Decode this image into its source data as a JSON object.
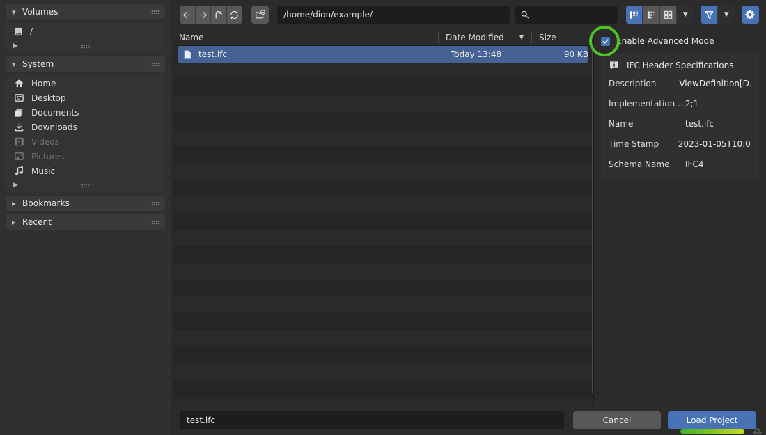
{
  "theme": {
    "accent_blue": "#4772b3",
    "selection_blue": "#466193",
    "highlight_green": "#4fc229",
    "panel_bg": "#2b2b2b",
    "sidebar_bg": "#303030",
    "list_bg": "#282828"
  },
  "sidebar": {
    "sections": [
      {
        "id": "volumes",
        "title": "Volumes",
        "expanded": true,
        "items": [
          {
            "label": "/",
            "icon": "drive-icon"
          }
        ]
      },
      {
        "id": "system",
        "title": "System",
        "expanded": true,
        "items": [
          {
            "label": "Home",
            "icon": "home-icon",
            "enabled": true
          },
          {
            "label": "Desktop",
            "icon": "desktop-icon",
            "enabled": true
          },
          {
            "label": "Documents",
            "icon": "documents-icon",
            "enabled": true
          },
          {
            "label": "Downloads",
            "icon": "download-icon",
            "enabled": true
          },
          {
            "label": "Videos",
            "icon": "video-icon",
            "enabled": false
          },
          {
            "label": "Pictures",
            "icon": "image-icon",
            "enabled": false
          },
          {
            "label": "Music",
            "icon": "music-icon",
            "enabled": true
          }
        ]
      },
      {
        "id": "bookmarks",
        "title": "Bookmarks",
        "expanded": false,
        "items": []
      },
      {
        "id": "recent",
        "title": "Recent",
        "expanded": false,
        "items": []
      }
    ]
  },
  "toolbar": {
    "nav": [
      {
        "name": "back-button",
        "icon": "arrow-left-icon"
      },
      {
        "name": "forward-button",
        "icon": "arrow-right-icon"
      },
      {
        "name": "parent-button",
        "icon": "arrow-up-icon"
      },
      {
        "name": "refresh-button",
        "icon": "refresh-icon"
      }
    ],
    "new_folder": {
      "name": "new-folder-button",
      "icon": "new-folder-icon"
    },
    "path": {
      "value": "/home/dion/example/",
      "placeholder": ""
    },
    "search": {
      "value": "",
      "placeholder": "",
      "icon": "search-icon"
    },
    "display_modes": [
      {
        "name": "vertical-list-view",
        "icon": "list-view-icon",
        "active": true
      },
      {
        "name": "horizontal-list-view",
        "icon": "detail-view-icon",
        "active": false
      },
      {
        "name": "thumbnail-view",
        "icon": "grid-view-icon",
        "active": false
      }
    ],
    "display_dropdown_icon": "chevron-down-icon",
    "filter": {
      "name": "filter-toggle",
      "icon": "funnel-icon",
      "active": true
    },
    "filter_dropdown_icon": "chevron-down-icon",
    "settings": {
      "name": "settings-button",
      "icon": "gear-icon"
    }
  },
  "filelist": {
    "columns": [
      {
        "key": "name",
        "label": "Name",
        "sorted": false
      },
      {
        "key": "date",
        "label": "Date Modified",
        "sorted": true,
        "direction": "desc"
      },
      {
        "key": "size",
        "label": "Size",
        "sorted": false
      }
    ],
    "files": [
      {
        "name": "test.ifc",
        "date": "Today 13:48",
        "size": "90 KB",
        "icon": "file-icon",
        "selected": true
      }
    ],
    "empty_row_count": 21
  },
  "rightpanel": {
    "advanced_mode": {
      "label": "Enable Advanced Mode",
      "checked": true
    },
    "card": {
      "title": "IFC Header Specifications",
      "icon": "info-icon",
      "properties": [
        {
          "key": "Description",
          "value": "ViewDefinition[D…"
        },
        {
          "key": "Implementation …",
          "value": "2;1"
        },
        {
          "key": "Name",
          "value": "test.ifc"
        },
        {
          "key": "Time Stamp",
          "value": "2023-01-05T10:0…"
        },
        {
          "key": "Schema Name",
          "value": "IFC4"
        }
      ]
    }
  },
  "bottom": {
    "filename": {
      "value": "test.ifc",
      "placeholder": ""
    },
    "cancel_label": "Cancel",
    "load_label": "Load Project"
  }
}
